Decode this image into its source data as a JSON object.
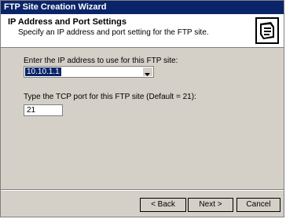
{
  "window": {
    "title": "FTP Site Creation Wizard"
  },
  "header": {
    "title": "IP Address and Port Settings",
    "subtitle": "Specify an IP address and port setting for the FTP site."
  },
  "form": {
    "ip_label": "Enter the IP address to use for this FTP site:",
    "ip_value": "10.10.1.1",
    "port_label": "Type the TCP port for this FTP site (Default = 21):",
    "port_value": "21"
  },
  "buttons": {
    "back": "< Back",
    "next": "Next >",
    "cancel": "Cancel"
  },
  "colors": {
    "titlebar": "#0a246a",
    "dialog_bg": "#d4d0c8",
    "selection": "#0a246a"
  },
  "icons": {
    "wizard": "ftp-wizard-icon",
    "dropdown": "chevron-down-icon"
  }
}
